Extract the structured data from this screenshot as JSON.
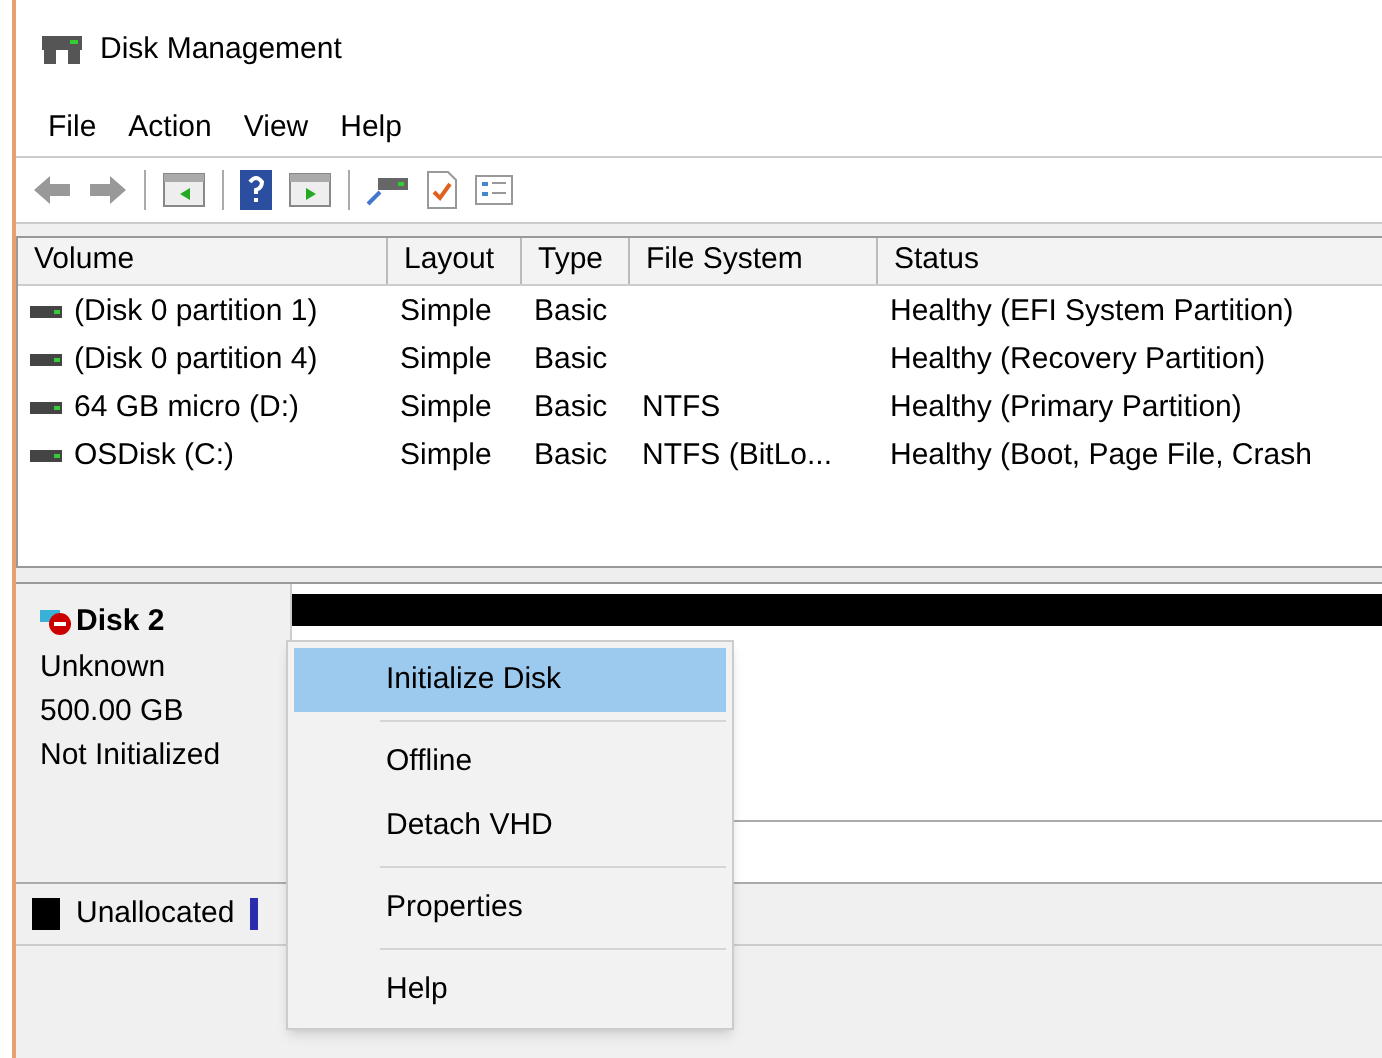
{
  "window": {
    "title": "Disk Management"
  },
  "menu_bar": [
    "File",
    "Action",
    "View",
    "Help"
  ],
  "table": {
    "columns": [
      "Volume",
      "Layout",
      "Type",
      "File System",
      "Status"
    ],
    "rows": [
      {
        "cells": [
          "(Disk 0 partition 1)",
          "Simple",
          "Basic",
          "",
          "Healthy (EFI System Partition)"
        ]
      },
      {
        "cells": [
          "(Disk 0 partition 4)",
          "Simple",
          "Basic",
          "",
          "Healthy (Recovery Partition)"
        ]
      },
      {
        "cells": [
          "64 GB micro (D:)",
          "Simple",
          "Basic",
          "NTFS",
          "Healthy (Primary Partition)"
        ]
      },
      {
        "cells": [
          "OSDisk (C:)",
          "Simple",
          "Basic",
          "NTFS (BitLo...",
          "Healthy (Boot, Page File, Crash"
        ]
      }
    ]
  },
  "disk": {
    "name": "Disk 2",
    "lines": [
      "Unknown",
      "500.00 GB",
      "Not Initialized"
    ]
  },
  "legend": [
    {
      "label": "Unallocated",
      "color": "#000000"
    }
  ],
  "context_menu": [
    {
      "kind": "item",
      "label": "Initialize Disk",
      "selected": true
    },
    {
      "kind": "separator"
    },
    {
      "kind": "item",
      "label": "Offline",
      "selected": false
    },
    {
      "kind": "item",
      "label": "Detach VHD",
      "selected": false
    },
    {
      "kind": "separator"
    },
    {
      "kind": "item",
      "label": "Properties",
      "selected": false
    },
    {
      "kind": "separator"
    },
    {
      "kind": "item",
      "label": "Help",
      "selected": false
    }
  ]
}
